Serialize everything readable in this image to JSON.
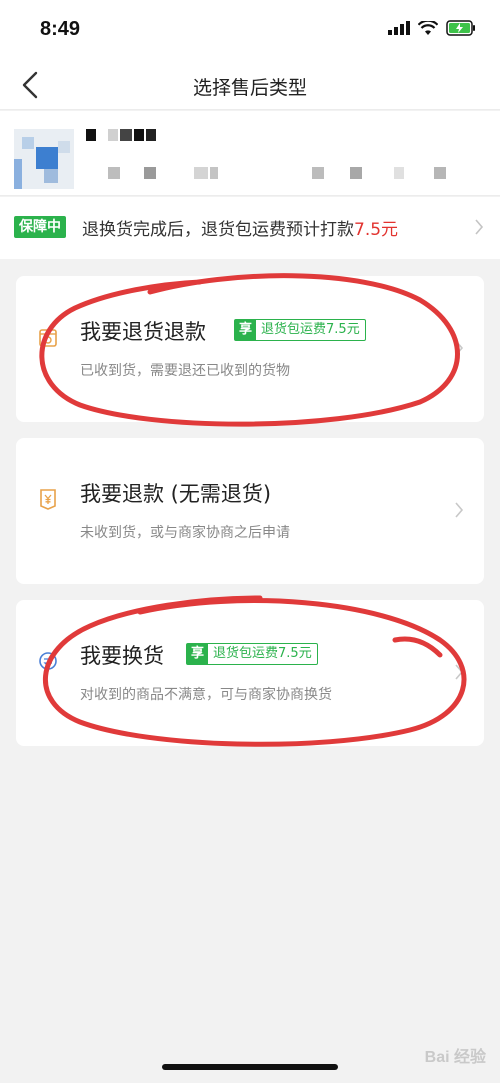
{
  "status_bar": {
    "time": "8:49"
  },
  "nav": {
    "title": "选择售后类型"
  },
  "guarantee": {
    "badge": "保障中",
    "text": "退换货完成后，退货包运费预计打款",
    "amount": "7.5元"
  },
  "options": [
    {
      "title": "我要退货退款",
      "tag_prefix": "享",
      "tag_text": "退货包运费7.5元",
      "subtitle": "已收到货，需要退还已收到的货物",
      "icon": "return-box-icon"
    },
    {
      "title": "我要退款 (无需退货)",
      "subtitle": "未收到货，或与商家协商之后申请",
      "icon": "yen-refund-icon"
    },
    {
      "title": "我要换货",
      "tag_prefix": "享",
      "tag_text": "退货包运费7.5元",
      "subtitle": "对收到的商品不满意，可与商家协商换货",
      "icon": "exchange-icon"
    }
  ],
  "watermark": "Bai 经验",
  "colors": {
    "green": "#2bb24c",
    "red_price": "#e2332f",
    "annotation_red": "#e03a3a",
    "orange_icon": "#e8a24a"
  }
}
